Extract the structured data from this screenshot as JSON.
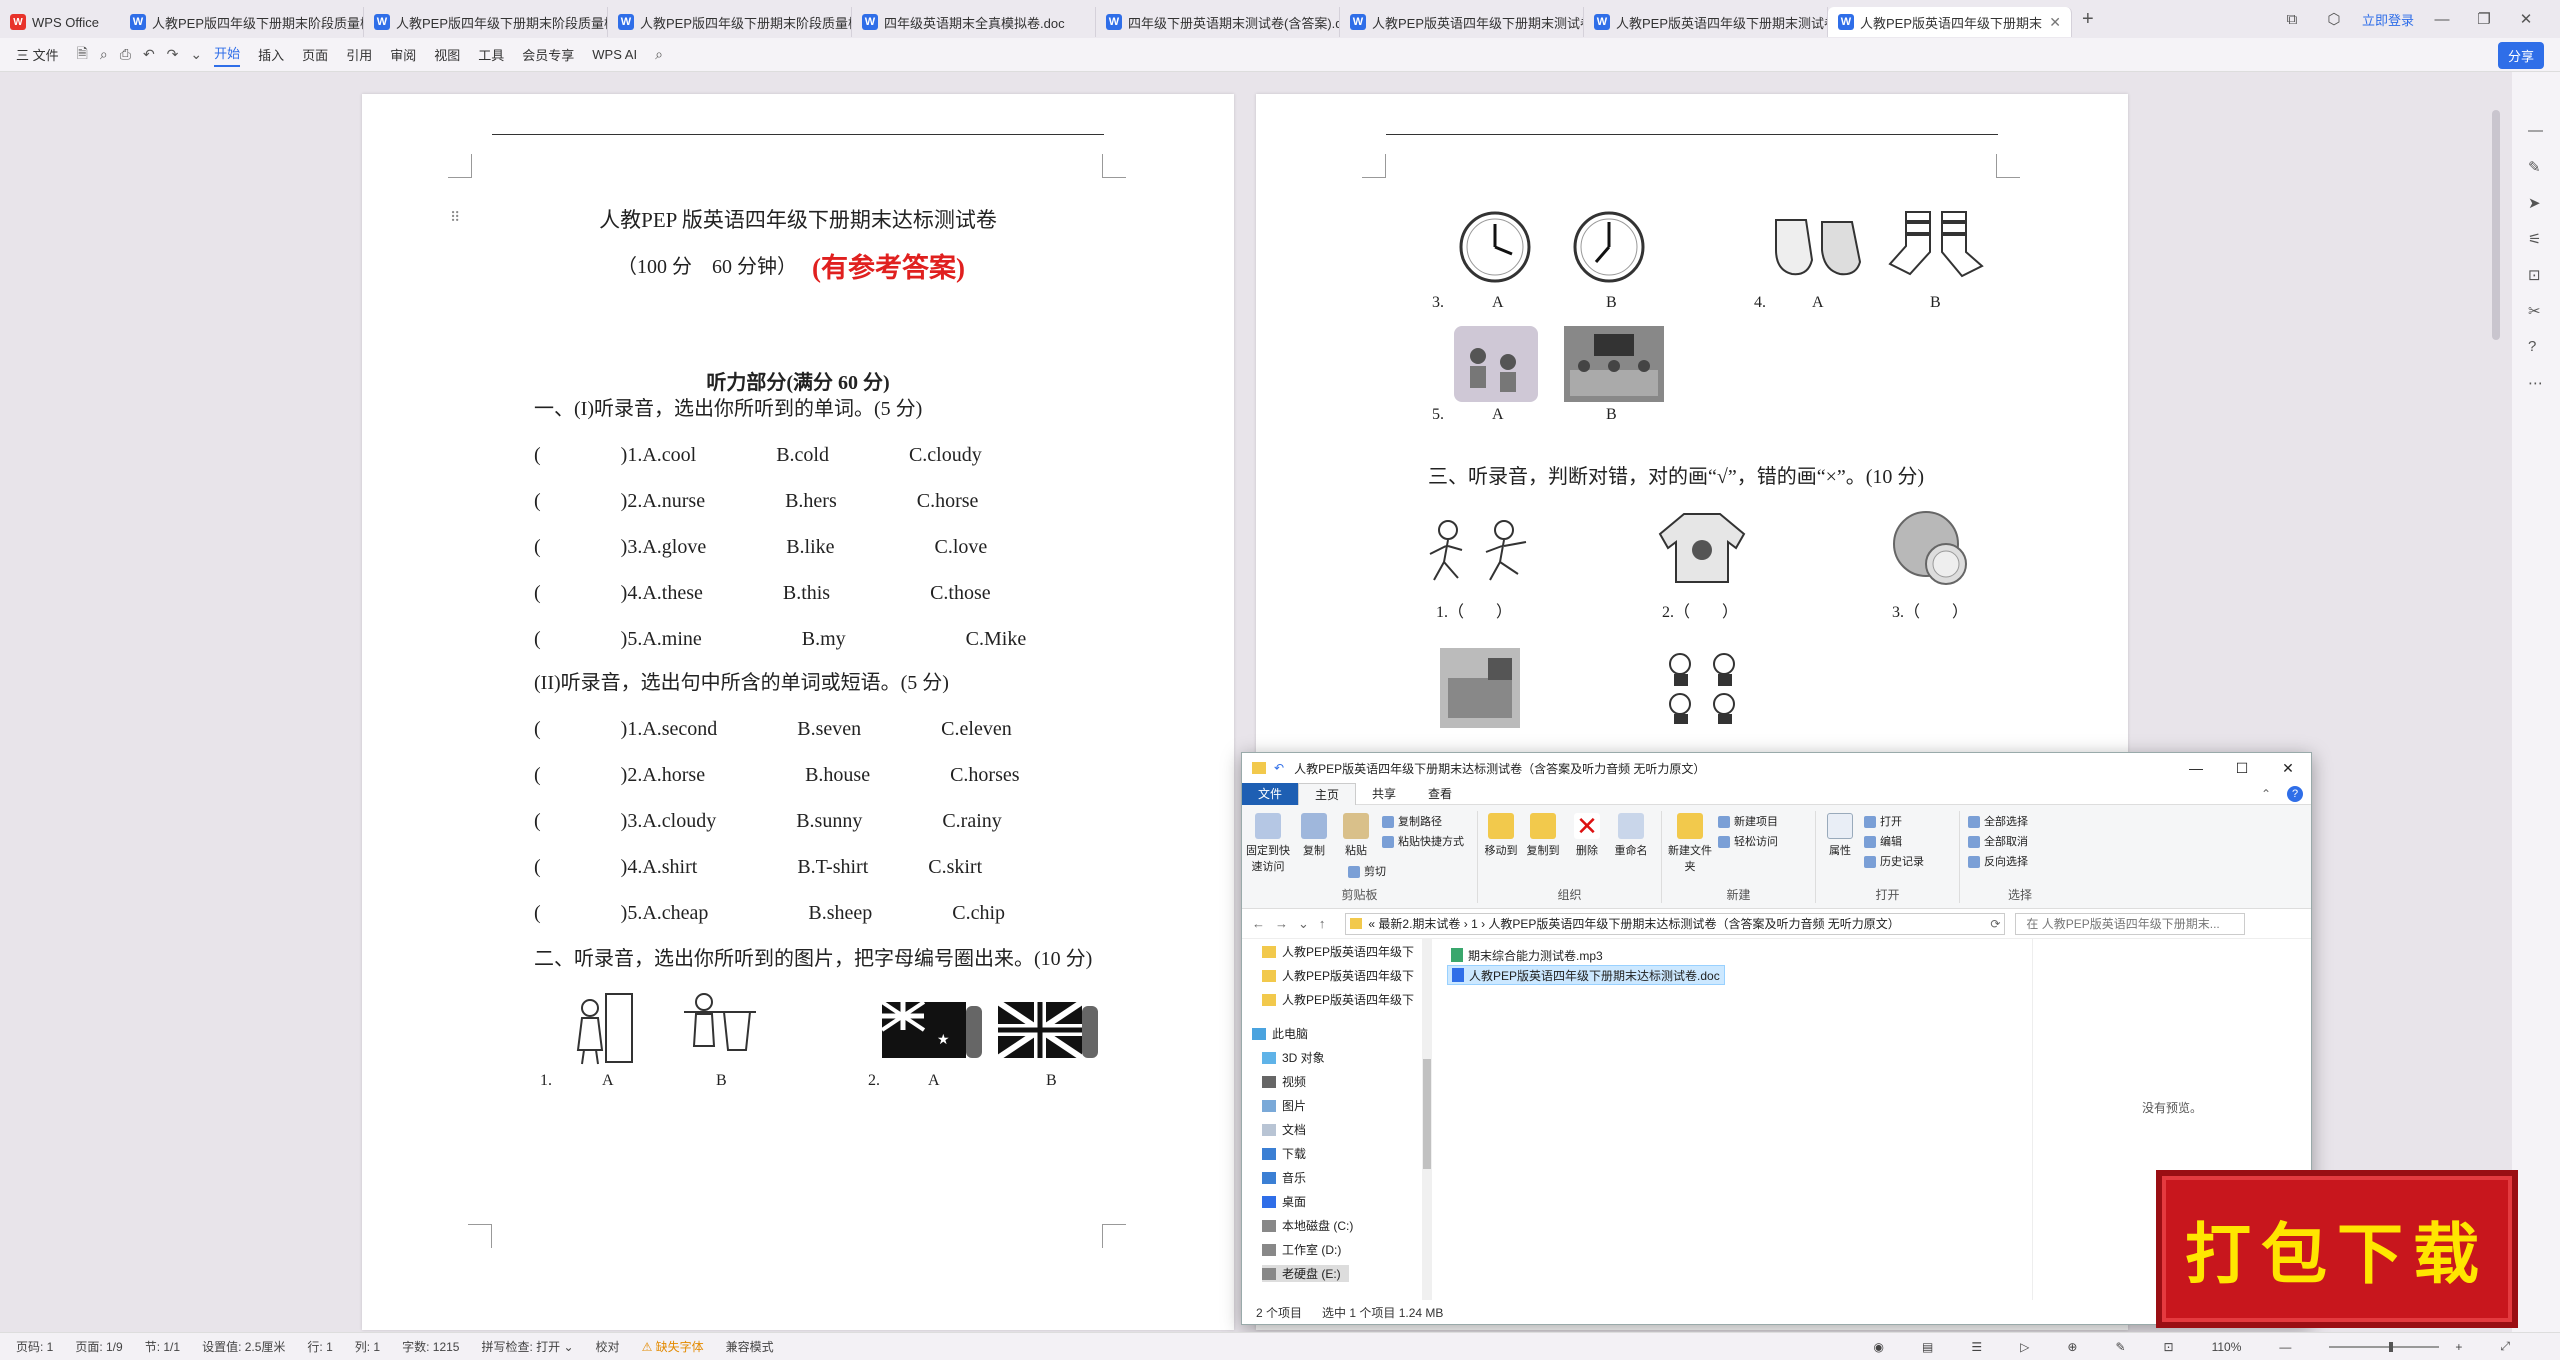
{
  "tabbar": {
    "tabs": [
      {
        "label": "WPS Office",
        "kind": "wps"
      },
      {
        "label": "人教PEP版四年级下册期末阶段质量检",
        "kind": "w"
      },
      {
        "label": "人教PEP版四年级下册期末阶段质量检",
        "kind": "w"
      },
      {
        "label": "人教PEP版四年级下册期末阶段质量检",
        "kind": "w"
      },
      {
        "label": "四年级英语期末全真模拟卷.doc",
        "kind": "w"
      },
      {
        "label": "四年级下册英语期末测试卷(含答案).d",
        "kind": "w"
      },
      {
        "label": "人教PEP版英语四年级下册期末测试卷",
        "kind": "w"
      },
      {
        "label": "人教PEP版英语四年级下册期末测试卷",
        "kind": "w"
      },
      {
        "label": "人教PEP版英语四年级下册期末",
        "kind": "w",
        "active": true
      }
    ],
    "login_label": "立即登录"
  },
  "toolbar": {
    "file_label": "三 文件",
    "items": [
      "开始",
      "插入",
      "页面",
      "引用",
      "审阅",
      "视图",
      "工具",
      "会员专享"
    ],
    "active": "开始",
    "wps_ai": "WPS AI",
    "share_label": "分享"
  },
  "page1": {
    "title": "人教PEP 版英语四年级下册期末达标测试卷",
    "subtitle": "（100 分　60 分钟）",
    "answer_note": "(有参考答案)",
    "section": "听力部分(满分 60 分)",
    "lines": [
      "一、(I)听录音，选出你所听到的单词。(5 分)",
      "(　　　　)1.A.cool　　　　B.cold　　　　C.cloudy",
      "(　　　　)2.A.nurse　　　　B.hers　　　　C.horse",
      "(　　　　)3.A.glove　　　　B.like　　　　　C.love",
      "(　　　　)4.A.these　　　　B.this　　　　　C.those",
      "(　　　　)5.A.mine　　　　　B.my　　　　　　C.Mike",
      "(II)听录音，选出句中所含的单词或短语。(5 分)",
      "(　　　　)1.A.second　　　　B.seven　　　　C.eleven",
      "(　　　　)2.A.horse　　　　　B.house　　　　C.horses",
      "(　　　　)3.A.cloudy　　　　B.sunny　　　　C.rainy",
      "(　　　　)4.A.shirt　　　　　B.T-shirt　　　C.skirt",
      "(　　　　)5.A.cheap　　　　　B.sheep　　　　C.chip",
      "二、听录音，选出你所听到的图片，把字母编号圈出来。(10 分)"
    ],
    "q_labels": [
      "1.",
      "A",
      "B",
      "2.",
      "A",
      "B"
    ]
  },
  "page2": {
    "q_labels": [
      "3.",
      "A",
      "B",
      "4.",
      "A",
      "B",
      "5.",
      "A",
      "B"
    ],
    "section3": "三、听录音，判断对错，对的画“√”，错的画“×”。(10 分)",
    "tf_labels": [
      "1.（　　）",
      "2.（　　）",
      "3.（　　）"
    ]
  },
  "explorer": {
    "title": "人教PEP版英语四年级下册期末达标测试卷（含答案及听力音频 无听力原文）",
    "tabs": [
      "文件",
      "主页",
      "共享",
      "查看"
    ],
    "ribbon": {
      "pin_label": "固定到快速访问",
      "copy_label": "复制",
      "paste_label": "粘贴",
      "copy_path": "复制路径",
      "paste_shortcut": "粘贴快捷方式",
      "cut": "剪切",
      "clipboard_group": "剪贴板",
      "move_to": "移动到",
      "copy_to": "复制到",
      "delete": "删除",
      "rename": "重命名",
      "organize_group": "组织",
      "new_folder": "新建文件夹",
      "new_item": "新建项目",
      "easy_access": "轻松访问",
      "new_group": "新建",
      "properties": "属性",
      "open": "打开",
      "edit": "编辑",
      "history": "历史记录",
      "open_group": "打开",
      "select_all": "全部选择",
      "select_none": "全部取消",
      "invert": "反向选择",
      "select_group": "选择"
    },
    "path": "«  最新2.期末试卷  ›  1  ›  人教PEP版英语四年级下册期末达标测试卷（含答案及听力音频 无听力原文）",
    "search_placeholder": "在 人教PEP版英语四年级下册期末...",
    "nav": [
      "人教PEP版英语四年级下",
      "人教PEP版英语四年级下",
      "人教PEP版英语四年级下",
      "此电脑",
      "3D 对象",
      "视频",
      "图片",
      "文档",
      "下载",
      "音乐",
      "桌面",
      "本地磁盘 (C:)",
      "工作室 (D:)",
      "老硬盘 (E:)"
    ],
    "files": [
      {
        "name": "期末综合能力测试卷.mp3",
        "type": "mp3"
      },
      {
        "name": "人教PEP版英语四年级下册期末达标测试卷.doc",
        "type": "doc",
        "selected": true
      }
    ],
    "preview": "没有预览。",
    "status_count": "2 个项目",
    "status_selected": "选中 1 个项目  1.24 MB"
  },
  "badge": "打包下载",
  "statusbar": {
    "items": [
      "页码: 1",
      "页面: 1/9",
      "节: 1/1",
      "设置值: 2.5厘米",
      "行: 1",
      "列: 1",
      "字数: 1215",
      "拼写检查: 打开 ⌄",
      "校对"
    ],
    "warn": "⚠ 缺失字体",
    "compat": "兼容模式",
    "zoom": "110%"
  },
  "colors": {
    "accent": "#2f6ee8",
    "answer_red": "#e0201f",
    "badge_red": "#c8161d",
    "badge_text": "#ffe600"
  }
}
